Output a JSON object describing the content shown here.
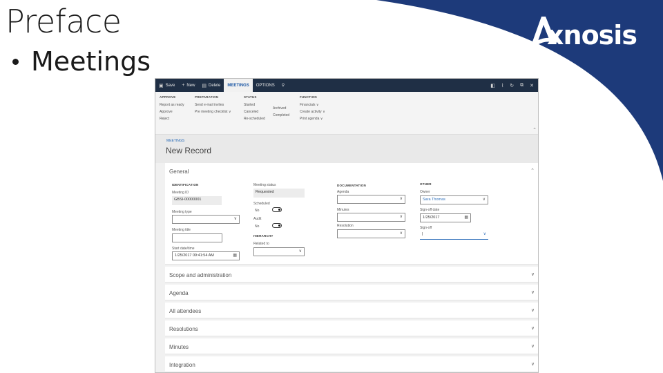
{
  "slide": {
    "title": "Preface",
    "bullet": "Meetings",
    "logo_text": "xnosis",
    "logo_color": "#1d3a7a"
  },
  "app": {
    "commandbar": {
      "save": "Save",
      "new": "New",
      "delete": "Delete",
      "tab_meetings": "MEETINGS",
      "tab_options": "OPTIONS",
      "icons": [
        "office-icon",
        "attach-icon",
        "refresh-icon",
        "popout-icon",
        "close-icon"
      ]
    },
    "ribbon": {
      "approve": {
        "title": "APPROVE",
        "items": [
          "Report as ready",
          "Approve",
          "Reject"
        ]
      },
      "preparation": {
        "title": "PREPARATION",
        "items": [
          "Send e-mail invites",
          "Pre meeting checklist ∨"
        ]
      },
      "status": {
        "title": "STATUS",
        "col1": [
          "Started",
          "Canceled",
          "Re-scheduled"
        ],
        "col2": [
          "Archived",
          "Completed"
        ]
      },
      "function": {
        "title": "FUNCTION",
        "items": [
          "Financials ∨",
          "Create activity ∨",
          "Print agenda ∨"
        ]
      }
    },
    "breadcrumb": "MEETINGS",
    "record_title": "New Record",
    "general": {
      "title": "General",
      "identification": {
        "title": "IDENTIFICATION",
        "meeting_id_label": "Meeting ID",
        "meeting_id_value": "GBSI-00000001",
        "meeting_type_label": "Meeting type",
        "meeting_title_label": "Meeting title",
        "start_label": "Start date/time",
        "start_value": "1/25/2017 09:41:54 AM"
      },
      "status": {
        "meeting_status_label": "Meeting status",
        "meeting_status_value": "Requested",
        "scheduled_label": "Scheduled",
        "scheduled_value": "No",
        "audit_label": "Audit",
        "audit_value": "No"
      },
      "hierarchy": {
        "title": "HIERARCHY",
        "related_label": "Related to"
      },
      "documentation": {
        "title": "DOCUMENTATION",
        "agenda_label": "Agenda",
        "minutes_label": "Minutes",
        "resolution_label": "Resolution"
      },
      "other": {
        "title": "OTHER",
        "owner_label": "Owner",
        "owner_value": "Sara Thomas",
        "signoff_date_label": "Sign-off date",
        "signoff_date_value": "1/25/2017",
        "signoff_label": "Sign-off"
      }
    },
    "sections": [
      "Scope and administration",
      "Agenda",
      "All attendees",
      "Resolutions",
      "Minutes",
      "Integration"
    ]
  }
}
